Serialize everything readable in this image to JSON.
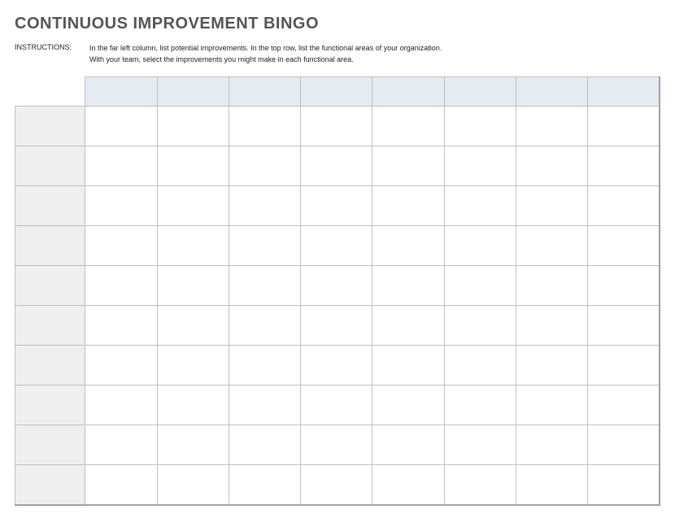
{
  "title": "CONTINUOUS IMPROVEMENT BINGO",
  "instructions": {
    "label": "INSTRUCTIONS:",
    "text": "In the far left column, list potential improvements. In the top row, list the functional areas of your organization.\nWith your team, select the improvements you might make in each functional area."
  },
  "grid": {
    "column_headers": [
      "",
      "",
      "",
      "",
      "",
      "",
      "",
      ""
    ],
    "row_headers": [
      "",
      "",
      "",
      "",
      "",
      "",
      "",
      "",
      "",
      ""
    ],
    "cells": [
      [
        "",
        "",
        "",
        "",
        "",
        "",
        "",
        ""
      ],
      [
        "",
        "",
        "",
        "",
        "",
        "",
        "",
        ""
      ],
      [
        "",
        "",
        "",
        "",
        "",
        "",
        "",
        ""
      ],
      [
        "",
        "",
        "",
        "",
        "",
        "",
        "",
        ""
      ],
      [
        "",
        "",
        "",
        "",
        "",
        "",
        "",
        ""
      ],
      [
        "",
        "",
        "",
        "",
        "",
        "",
        "",
        ""
      ],
      [
        "",
        "",
        "",
        "",
        "",
        "",
        "",
        ""
      ],
      [
        "",
        "",
        "",
        "",
        "",
        "",
        "",
        ""
      ],
      [
        "",
        "",
        "",
        "",
        "",
        "",
        "",
        ""
      ],
      [
        "",
        "",
        "",
        "",
        "",
        "",
        "",
        ""
      ]
    ]
  }
}
